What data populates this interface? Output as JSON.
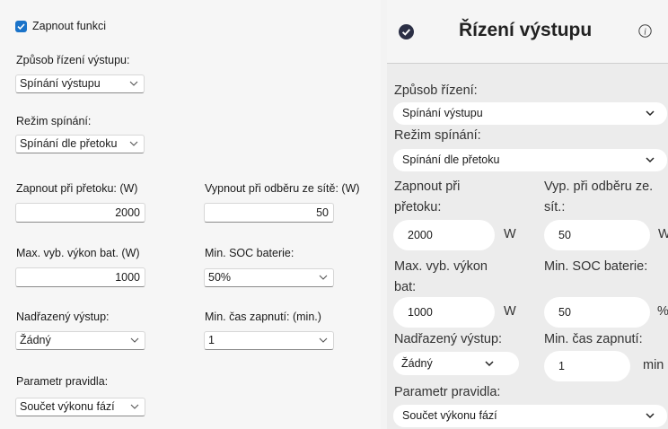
{
  "left": {
    "enable_label": "Zapnout funkci",
    "control_mode_label": "Způsob řízení výstupu:",
    "control_mode_value": "Spínání výstupu",
    "switch_mode_label": "Režim spínání:",
    "switch_mode_value": "Spínání dle přetoku",
    "on_overflow_label": "Zapnout při přetoku: (W)",
    "on_overflow_value": "2000",
    "off_grid_label": "Vypnout při odběru ze sítě: (W)",
    "off_grid_value": "50",
    "max_bat_label": "Max. vyb. výkon bat. (W)",
    "max_bat_value": "1000",
    "min_soc_label": "Min. SOC baterie:",
    "min_soc_value": "50%",
    "parent_output_label": "Nadřazený výstup:",
    "parent_output_value": "Žádný",
    "min_on_time_label": "Min. čas zapnutí: (min.)",
    "min_on_time_value": "1",
    "rule_param_label": "Parametr pravidla:",
    "rule_param_value": "Součet výkonu fází"
  },
  "right": {
    "title": "Řízení výstupu",
    "control_mode_label": "Způsob řízení:",
    "control_mode_value": "Spínání výstupu",
    "switch_mode_label": "Režim spínání:",
    "switch_mode_value": "Spínání dle přetoku",
    "on_overflow_label_1": "Zapnout při",
    "on_overflow_label_2": "přetoku:",
    "off_grid_label_1": "Vyp. při odběru ze.",
    "off_grid_label_2": "sít.:",
    "on_overflow_value": "2000",
    "on_overflow_unit": "W",
    "off_grid_value": "50",
    "off_grid_unit": "W",
    "max_bat_label_1": "Max. vyb. výkon",
    "max_bat_label_2": "bat:",
    "min_soc_label": "Min. SOC baterie:",
    "max_bat_value": "1000",
    "max_bat_unit": "W",
    "min_soc_value": "50",
    "min_soc_unit": "%",
    "parent_output_label": "Nadřazený výstup:",
    "min_on_time_label": "Min. čas zapnutí:",
    "parent_output_value": "Žádný",
    "min_on_time_value": "1",
    "min_on_time_unit": "min",
    "rule_param_label": "Parametr pravidla:",
    "rule_param_value": "Součet výkonu fází"
  },
  "colors": {
    "accent": "#1a73c9",
    "dark_icon": "#2b2f45"
  },
  "icons": {
    "checkbox": "check-icon",
    "status": "check-circle-icon",
    "info": "info-icon",
    "dropdown": "chevron-down-icon"
  }
}
